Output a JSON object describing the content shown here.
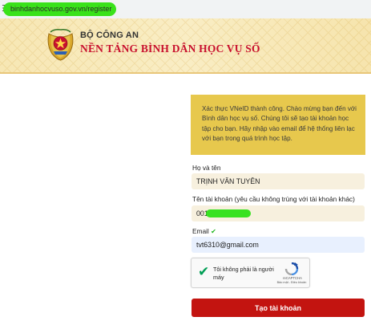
{
  "browser": {
    "url": "binhdanhocvuso.gov.vn/register",
    "icon": "site-settings-icon"
  },
  "header": {
    "logo_icon": "police-emblem-icon",
    "organization": "BỘ CÔNG AN",
    "platform_name": "NỀN TẢNG BÌNH DÂN HỌC VỤ SỐ",
    "accent_color": "#c8102e"
  },
  "notice": {
    "text": "Xác thực VNeID thành công. Chào mừng bạn đến với Bình dân học vụ số. Chúng tôi sẽ tạo tài khoản học tập cho bạn. Hãy nhập vào email để hệ thống liên lạc với bạn trong quá trình học tập.",
    "background": "#e7c84d"
  },
  "form": {
    "fullname_label": "Họ và tên",
    "fullname_value": "TRỊNH VĂN TUYÊN",
    "username_label": "Tên tài khoản (yêu cầu không trùng với tài khoản khác)",
    "username_value": "0010",
    "email_label": "Email",
    "email_verified_icon": "checkmark-icon",
    "email_value": "tvt6310@gmail.com",
    "submit_label": "Tạo tài khoản",
    "submit_color": "#c31410"
  },
  "captcha": {
    "label": "Tôi không phải là người máy",
    "brand": "reCAPTCHA",
    "terms": "Bảo mật - Điều khoản",
    "checked": true,
    "check_color": "#009e55"
  }
}
